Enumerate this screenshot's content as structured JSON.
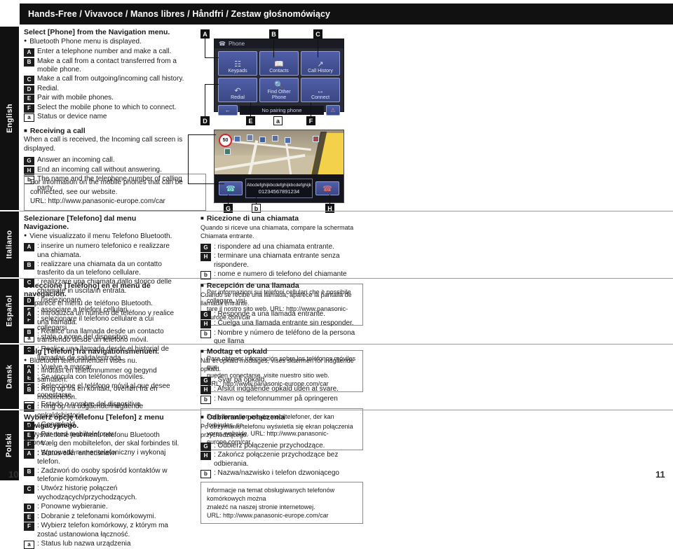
{
  "title": "Hands-Free / Vivavoce / Manos libres / Håndfri / Zestaw głośnomówiący",
  "page_numbers": {
    "left": "10",
    "right": "11"
  },
  "language_tabs": {
    "english": "English",
    "italiano": "Italiano",
    "espanol": "Español",
    "dansk": "Dansk",
    "polski": "Polski"
  },
  "device_screens": {
    "phone_menu": {
      "header": "Phone",
      "buttons": [
        {
          "label": "Keypads",
          "icon": "keypad-icon"
        },
        {
          "label": "Contacts",
          "icon": "contacts-book-icon"
        },
        {
          "label": "Call History",
          "icon": "call-history-icon"
        },
        {
          "label": "Redial",
          "icon": "redial-icon"
        },
        {
          "label": "Find Other Phone",
          "icon": "find-phone-icon"
        },
        {
          "label": "Connect",
          "icon": "connect-icon"
        }
      ],
      "back_icon": "back-arrow-icon",
      "status": "No pairing phone",
      "right_icon": "warning-icon"
    },
    "incoming_call": {
      "speed_limit": "50",
      "caller_name": "Abcdefghijkbcdefghijkbcdefghijk",
      "caller_number": "01234567891234",
      "answer_icon": "answer-call-icon",
      "end_icon": "end-call-icon"
    }
  },
  "callout_markers": {
    "A": "A",
    "B": "B",
    "C": "C",
    "D": "D",
    "E": "E",
    "F": "F",
    "G": "G",
    "H": "H",
    "a": "a",
    "b": "b"
  },
  "english": {
    "heading": "Select [Phone] from the Navigation menu.",
    "bullet": "Bluetooth Phone menu is displayed.",
    "keys": [
      {
        "key": "A",
        "lower": false,
        "text": "Enter a telephone number and make a call."
      },
      {
        "key": "B",
        "lower": false,
        "text": "Make a call from a contact transferred from a mobile phone."
      },
      {
        "key": "C",
        "lower": false,
        "text": "Make a call from outgoing/incoming call history."
      },
      {
        "key": "D",
        "lower": false,
        "text": "Redial."
      },
      {
        "key": "E",
        "lower": false,
        "text": "Pair with mobile phones."
      },
      {
        "key": "F",
        "lower": false,
        "text": "Select the mobile phone to which to connect."
      },
      {
        "key": "a",
        "lower": true,
        "text": "Status or device name"
      }
    ],
    "sub_heading": "Receiving a call",
    "sub_text": "When a call is received, the Incoming call screen is displayed.",
    "sub_keys": [
      {
        "key": "G",
        "lower": false,
        "text": "Answer an incoming call."
      },
      {
        "key": "H",
        "lower": false,
        "text": "End an incoming call without answering."
      },
      {
        "key": "b",
        "lower": true,
        "text": "The name and the telephone number of calling party"
      }
    ],
    "note": [
      "For information on the mobile phones that can be",
      "connected, see our website.",
      "URL:  http://www.panasonic-europe.com/car"
    ]
  },
  "italiano": {
    "heading": "Selezionare [Telefono] dal menu Navigazione.",
    "bullet": "Viene visualizzato il menu Telefono Bluetooth.",
    "keys": [
      {
        "key": "A",
        "lower": false,
        "text": ": inserire un numero telefonico e realizzare una chiamata."
      },
      {
        "key": "B",
        "lower": false,
        "text": ": realizzare una chiamata da un contatto trasferito da un telefono cellulare."
      },
      {
        "key": "C",
        "lower": false,
        "text": ": realizzare una chiamata dallo storico delle chiamate in uscita/in entrata."
      },
      {
        "key": "D",
        "lower": false,
        "text": ": riselezionare."
      },
      {
        "key": "E",
        "lower": false,
        "text": ": associare a telefoni cellulari."
      },
      {
        "key": "F",
        "lower": false,
        "text": ": selezionare il telefono cellulare a cui collegarsi."
      },
      {
        "key": "a",
        "lower": true,
        "text": ": stato o nome del dispositivo"
      }
    ],
    "sub_heading": "Ricezione di una chiamata",
    "sub_text": "Quando si riceve una chiamata, compare la schermata Chiamata entrante.",
    "sub_keys": [
      {
        "key": "G",
        "lower": false,
        "text": ": rispondere ad una chiamata entrante."
      },
      {
        "key": "H",
        "lower": false,
        "text": ": terminare una chiamata entrante senza rispondere."
      },
      {
        "key": "b",
        "lower": true,
        "text": ": nome e numero di telefono del chiamante"
      }
    ],
    "note": [
      "Per informazioni sui telefoni cellulari che è possibile collegare, visi-",
      "tare il nostro sito web. URL:  http://www.panasonic-europe.com/car"
    ]
  },
  "espanol": {
    "heading": "Seleccione [Teléfono] en el menú de navegación.",
    "bullet": "Aparece el menú de teléfono Bluetooth.",
    "keys": [
      {
        "key": "A",
        "lower": false,
        "text": ": Introduzca un número de teléfono y realice una llamada."
      },
      {
        "key": "B",
        "lower": false,
        "text": ": Realice una llamada desde un contacto transferido desde un teléfono móvil."
      },
      {
        "key": "C",
        "lower": false,
        "text": ": Realice una llamada desde el historial de llamadas de salida/entrada."
      },
      {
        "key": "D",
        "lower": false,
        "text": ": Vuelve a marcar."
      },
      {
        "key": "E",
        "lower": false,
        "text": ": Se vincula con teléfonos móviles."
      },
      {
        "key": "F",
        "lower": false,
        "text": ": Seleccione el teléfono móvil al que desee conectarse."
      },
      {
        "key": "a",
        "lower": true,
        "text": ": Estado o nombre del dispositivo"
      }
    ],
    "sub_heading": "Recepción de una llamada",
    "sub_text": "Cuando se recibe una llamada, aparece la pantalla de llamada entrante.",
    "sub_keys": [
      {
        "key": "G",
        "lower": false,
        "text": ": Responde a una llamada entrante."
      },
      {
        "key": "H",
        "lower": false,
        "text": ": Cuelga una llamada entrante sin responder."
      },
      {
        "key": "b",
        "lower": true,
        "text": ": Nombre y número de teléfono de la persona que llama"
      }
    ],
    "note": [
      "Para obtener información sobre los teléfonos móviles que",
      "pueden conectarse, visite nuestro sitio web.",
      "URL:  http://www.panasonic-europe.com/car"
    ]
  },
  "dansk": {
    "heading": "Vælg [Telefon] fra navigationsmenuen.",
    "bullet": "Bluetooth telefonmenuen vises nu.",
    "keys": [
      {
        "key": "A",
        "lower": false,
        "text": ": Iindtast en telefonnummer og begynd samtalen."
      },
      {
        "key": "B",
        "lower": false,
        "text": ": Ring op fra en kontakt, overført fra en mobiltelefon."
      },
      {
        "key": "C",
        "lower": false,
        "text": ": Ring op fra udgående/indgående opkaldshistorie."
      },
      {
        "key": "D",
        "lower": false,
        "text": ": Genopkald."
      },
      {
        "key": "E",
        "lower": false,
        "text": ": Par med mobiltelefoner."
      },
      {
        "key": "F",
        "lower": false,
        "text": ": Vælg den mobiltelefon, der skal forbindes til."
      },
      {
        "key": "a",
        "lower": true,
        "text": ": Status eller enhedsnavn"
      }
    ],
    "sub_heading": "Modtag et opkald",
    "sub_text": "Når et opkald modtages, vises skærmen for indgående opkald.",
    "sub_keys": [
      {
        "key": "G",
        "lower": false,
        "text": ": Svar på opkald."
      },
      {
        "key": "H",
        "lower": false,
        "text": ": Afslut indgående opkald uden at svare."
      },
      {
        "key": "b",
        "lower": true,
        "text": ": Navn og telefonnummer på opringeren"
      }
    ],
    "note": [
      "For information om de mobiltelefoner, der kan forbindes, se",
      "vores webside. URL:  http://www.panasonic-europe.com/car"
    ]
  },
  "polski": {
    "heading": "Wybierz opcję telefonu [Telefon] z menu nawigacyjnego.",
    "bullet": "Wyświetlone jest menu telefonu Bluetooth Phone.",
    "keys": [
      {
        "key": "A",
        "lower": false,
        "text": ": Wprowadź numer telefoniczny i wykonaj telefon."
      },
      {
        "key": "B",
        "lower": false,
        "text": ": Zadzwoń do osoby spośród kontaktów w telefonie komórkowym."
      },
      {
        "key": "C",
        "lower": false,
        "text": ": Utwórz historię połączeń wychodzących/przychodzących."
      },
      {
        "key": "D",
        "lower": false,
        "text": ": Ponowne wybieranie."
      },
      {
        "key": "E",
        "lower": false,
        "text": ": Dobranie z telefonami komórkowymi."
      },
      {
        "key": "F",
        "lower": false,
        "text": ": Wybierz telefon komórkowy, z którym ma zostać ustanowiona łączność."
      },
      {
        "key": "a",
        "lower": true,
        "text": ": Status lub nazwa urządzenia"
      }
    ],
    "sub_heading": "Odbieranie połączenia",
    "sub_text": "Po otrzymaniu telefonu wyświetla się ekran połączenia przychodzącego.",
    "sub_keys": [
      {
        "key": "G",
        "lower": false,
        "text": ": Odbierz połączenie przychodzące."
      },
      {
        "key": "H",
        "lower": false,
        "text": ": Zakończ połączenie przychodzące bez odbierania."
      },
      {
        "key": "b",
        "lower": true,
        "text": ": Nazwa/nazwisko i telefon dzwoniącego"
      }
    ],
    "note": [
      "Informacje na temat obsługiwanych telefonów komórkowych można",
      "znaleźć na naszej stronie internetowej.",
      "URL:  http://www.panasonic-europe.com/car"
    ]
  }
}
